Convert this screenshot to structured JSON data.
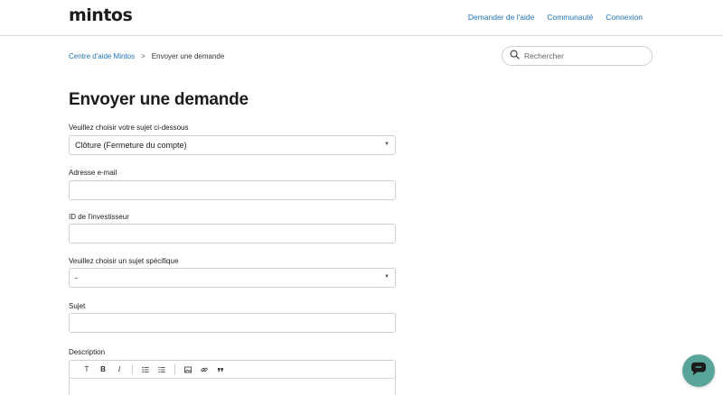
{
  "header": {
    "logo": "mintos",
    "nav": [
      {
        "label": "Demander de l'aide"
      },
      {
        "label": "Communauté"
      },
      {
        "label": "Connexion"
      }
    ]
  },
  "breadcrumb": {
    "home": "Centre d'aide Mintos",
    "separator": ">",
    "current": "Envoyer une demande"
  },
  "search": {
    "placeholder": "Rechercher"
  },
  "page_title": "Envoyer une demande",
  "form": {
    "subject_select": {
      "label": "Veuillez choisir votre sujet ci-dessous",
      "value": "Clôture (Fermeture du compte)"
    },
    "email": {
      "label": "Adresse e-mail",
      "value": ""
    },
    "investor_id": {
      "label": "ID de l'investisseur",
      "value": ""
    },
    "specific_subject": {
      "label": "Veuillez choisir un sujet spécifique",
      "value": "-"
    },
    "subject": {
      "label": "Sujet",
      "value": ""
    },
    "description": {
      "label": "Description"
    }
  },
  "editor_toolbar": {
    "text_style": "T",
    "bold": "B",
    "italic": "I"
  },
  "colors": {
    "link": "#1f73b7",
    "chat_button": "#5aa59b",
    "border": "#cfcfcf"
  },
  "icons": [
    "search-icon",
    "bulleted-list-icon",
    "numbered-list-icon",
    "image-icon",
    "link-icon",
    "quote-icon",
    "chat-icon"
  ]
}
